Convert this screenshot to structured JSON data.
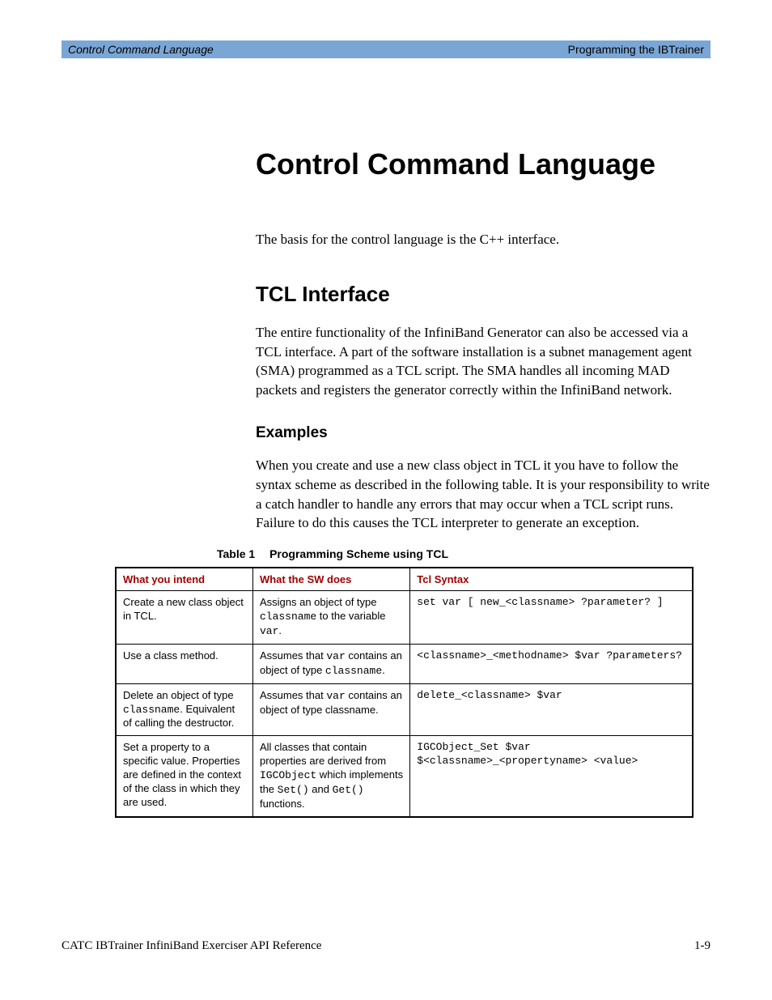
{
  "header": {
    "left": "Control Command Language",
    "right": "Programming the IBTrainer"
  },
  "title": "Control Command Language",
  "intro": "The basis for the control language is the C++ interface.",
  "section1": {
    "heading": "TCL Interface",
    "para": "The entire functionality of the InfiniBand Generator can also be accessed via a TCL interface. A part of the software installation is a subnet management agent (SMA) programmed as a TCL script. The SMA handles all incoming MAD packets and registers the generator correctly within the InfiniBand network."
  },
  "subsection1": {
    "heading": "Examples",
    "para": "When you create and use a new class object in TCL it you have to follow the syntax scheme as described in the following table. It is your responsibility to write a catch handler to handle any errors that may occur when a TCL script runs. Failure to do this causes the TCL interpreter to generate an exception."
  },
  "table": {
    "label": "Table 1",
    "caption": "Programming Scheme using TCL",
    "headers": [
      "What you intend",
      "What the SW does",
      "Tcl Syntax"
    ],
    "rows": [
      {
        "intend_html": "Create a new class object in TCL.",
        "sw_html": "Assigns an object of type <span class=\"mono\">classname</span> to the variable <span class=\"mono\">var</span>.",
        "syntax": "set var [ new_<classname> ?parameter? ]"
      },
      {
        "intend_html": "Use a class method.",
        "sw_html": "Assumes that <span class=\"mono\">var</span> contains an object of type <span class=\"mono\">classname</span>.",
        "syntax": "<classname>_<methodname> $var ?parameters?"
      },
      {
        "intend_html": "Delete an object of type <span class=\"mono\">classname</span>. Equivalent of calling the destructor.",
        "sw_html": "Assumes that <span class=\"mono\">var</span> contains an object of type classname.",
        "syntax": "delete_<classname> $var"
      },
      {
        "intend_html": "Set a property to a specific value. Properties are defined in the context of the class in which they are used.",
        "sw_html": "All classes that contain properties are derived from <span class=\"mono\">IGCObject</span> which implements the <span class=\"mono\">Set()</span> and <span class=\"mono\">Get()</span> functions.",
        "syntax": "IGCObject_Set $var\n$<classname>_<propertyname> <value>"
      }
    ]
  },
  "footer": {
    "left": "CATC IBTrainer InfiniBand Exerciser API Reference",
    "right": "1-9"
  }
}
